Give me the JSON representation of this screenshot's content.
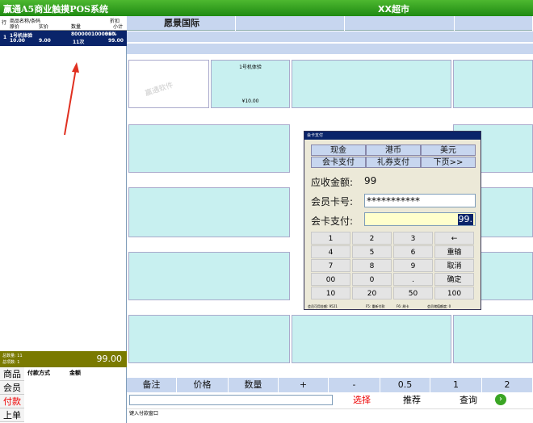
{
  "titlebar": {
    "app": "赢通A5商业触摸POS系统",
    "store": "XX超市"
  },
  "cart": {
    "header": {
      "code": "行",
      "name": "商品名称/条码",
      "price": "原价",
      "actual": "实价",
      "qty": "数量",
      "discount": "折扣",
      "subtotal": "小计"
    },
    "rows": [
      {
        "index": "1",
        "name": "1号机体验",
        "barcode": "8000001000010",
        "discount": "96%",
        "price": "10.00",
        "actual": "9.00",
        "qty": "11次",
        "subtotal": "99.00"
      }
    ],
    "totals": {
      "total_qty": "总数量: 11",
      "total_items": "总项数: 1",
      "amount": "99.00"
    }
  },
  "pay_panel": {
    "tabs": [
      "商品",
      "会员",
      "付款",
      "上单"
    ],
    "columns": {
      "method": "付款方式",
      "amount": "金额"
    }
  },
  "products": {
    "category": "愿景国际",
    "tiles": [
      {
        "name": "1号机体验",
        "price": "¥10.00"
      }
    ]
  },
  "bottombar": {
    "buttons": [
      "备注",
      "价格",
      "数量",
      "+",
      "-",
      "0.5",
      "1",
      "2"
    ]
  },
  "actionbar": {
    "select": "选择",
    "recommend": "推荐",
    "query": "查询"
  },
  "status": "键入付款窗口",
  "dialog": {
    "title": "会卡支付",
    "pay_methods": [
      "现金",
      "港币",
      "美元",
      "会卡支付",
      "礼券支付",
      "下页>>"
    ],
    "amount_due_label": "应收金额:",
    "amount_due_value": "99",
    "card_no_label": "会员卡号:",
    "card_no_value": "***********",
    "card_pay_label": "会卡支付:",
    "card_pay_value": "99.",
    "keypad": [
      [
        "1",
        "2",
        "3",
        "←"
      ],
      [
        "4",
        "5",
        "6",
        "重输"
      ],
      [
        "7",
        "8",
        "9",
        "取消"
      ],
      [
        "00",
        "0",
        ".",
        "确定"
      ],
      [
        "10",
        "20",
        "50",
        "100"
      ]
    ],
    "footer": {
      "balance": "会员可用金额: 9521",
      "f5": "F5: 重新付款",
      "f6": "F6: 刷卡",
      "points": "会员储值额度: 0"
    }
  }
}
